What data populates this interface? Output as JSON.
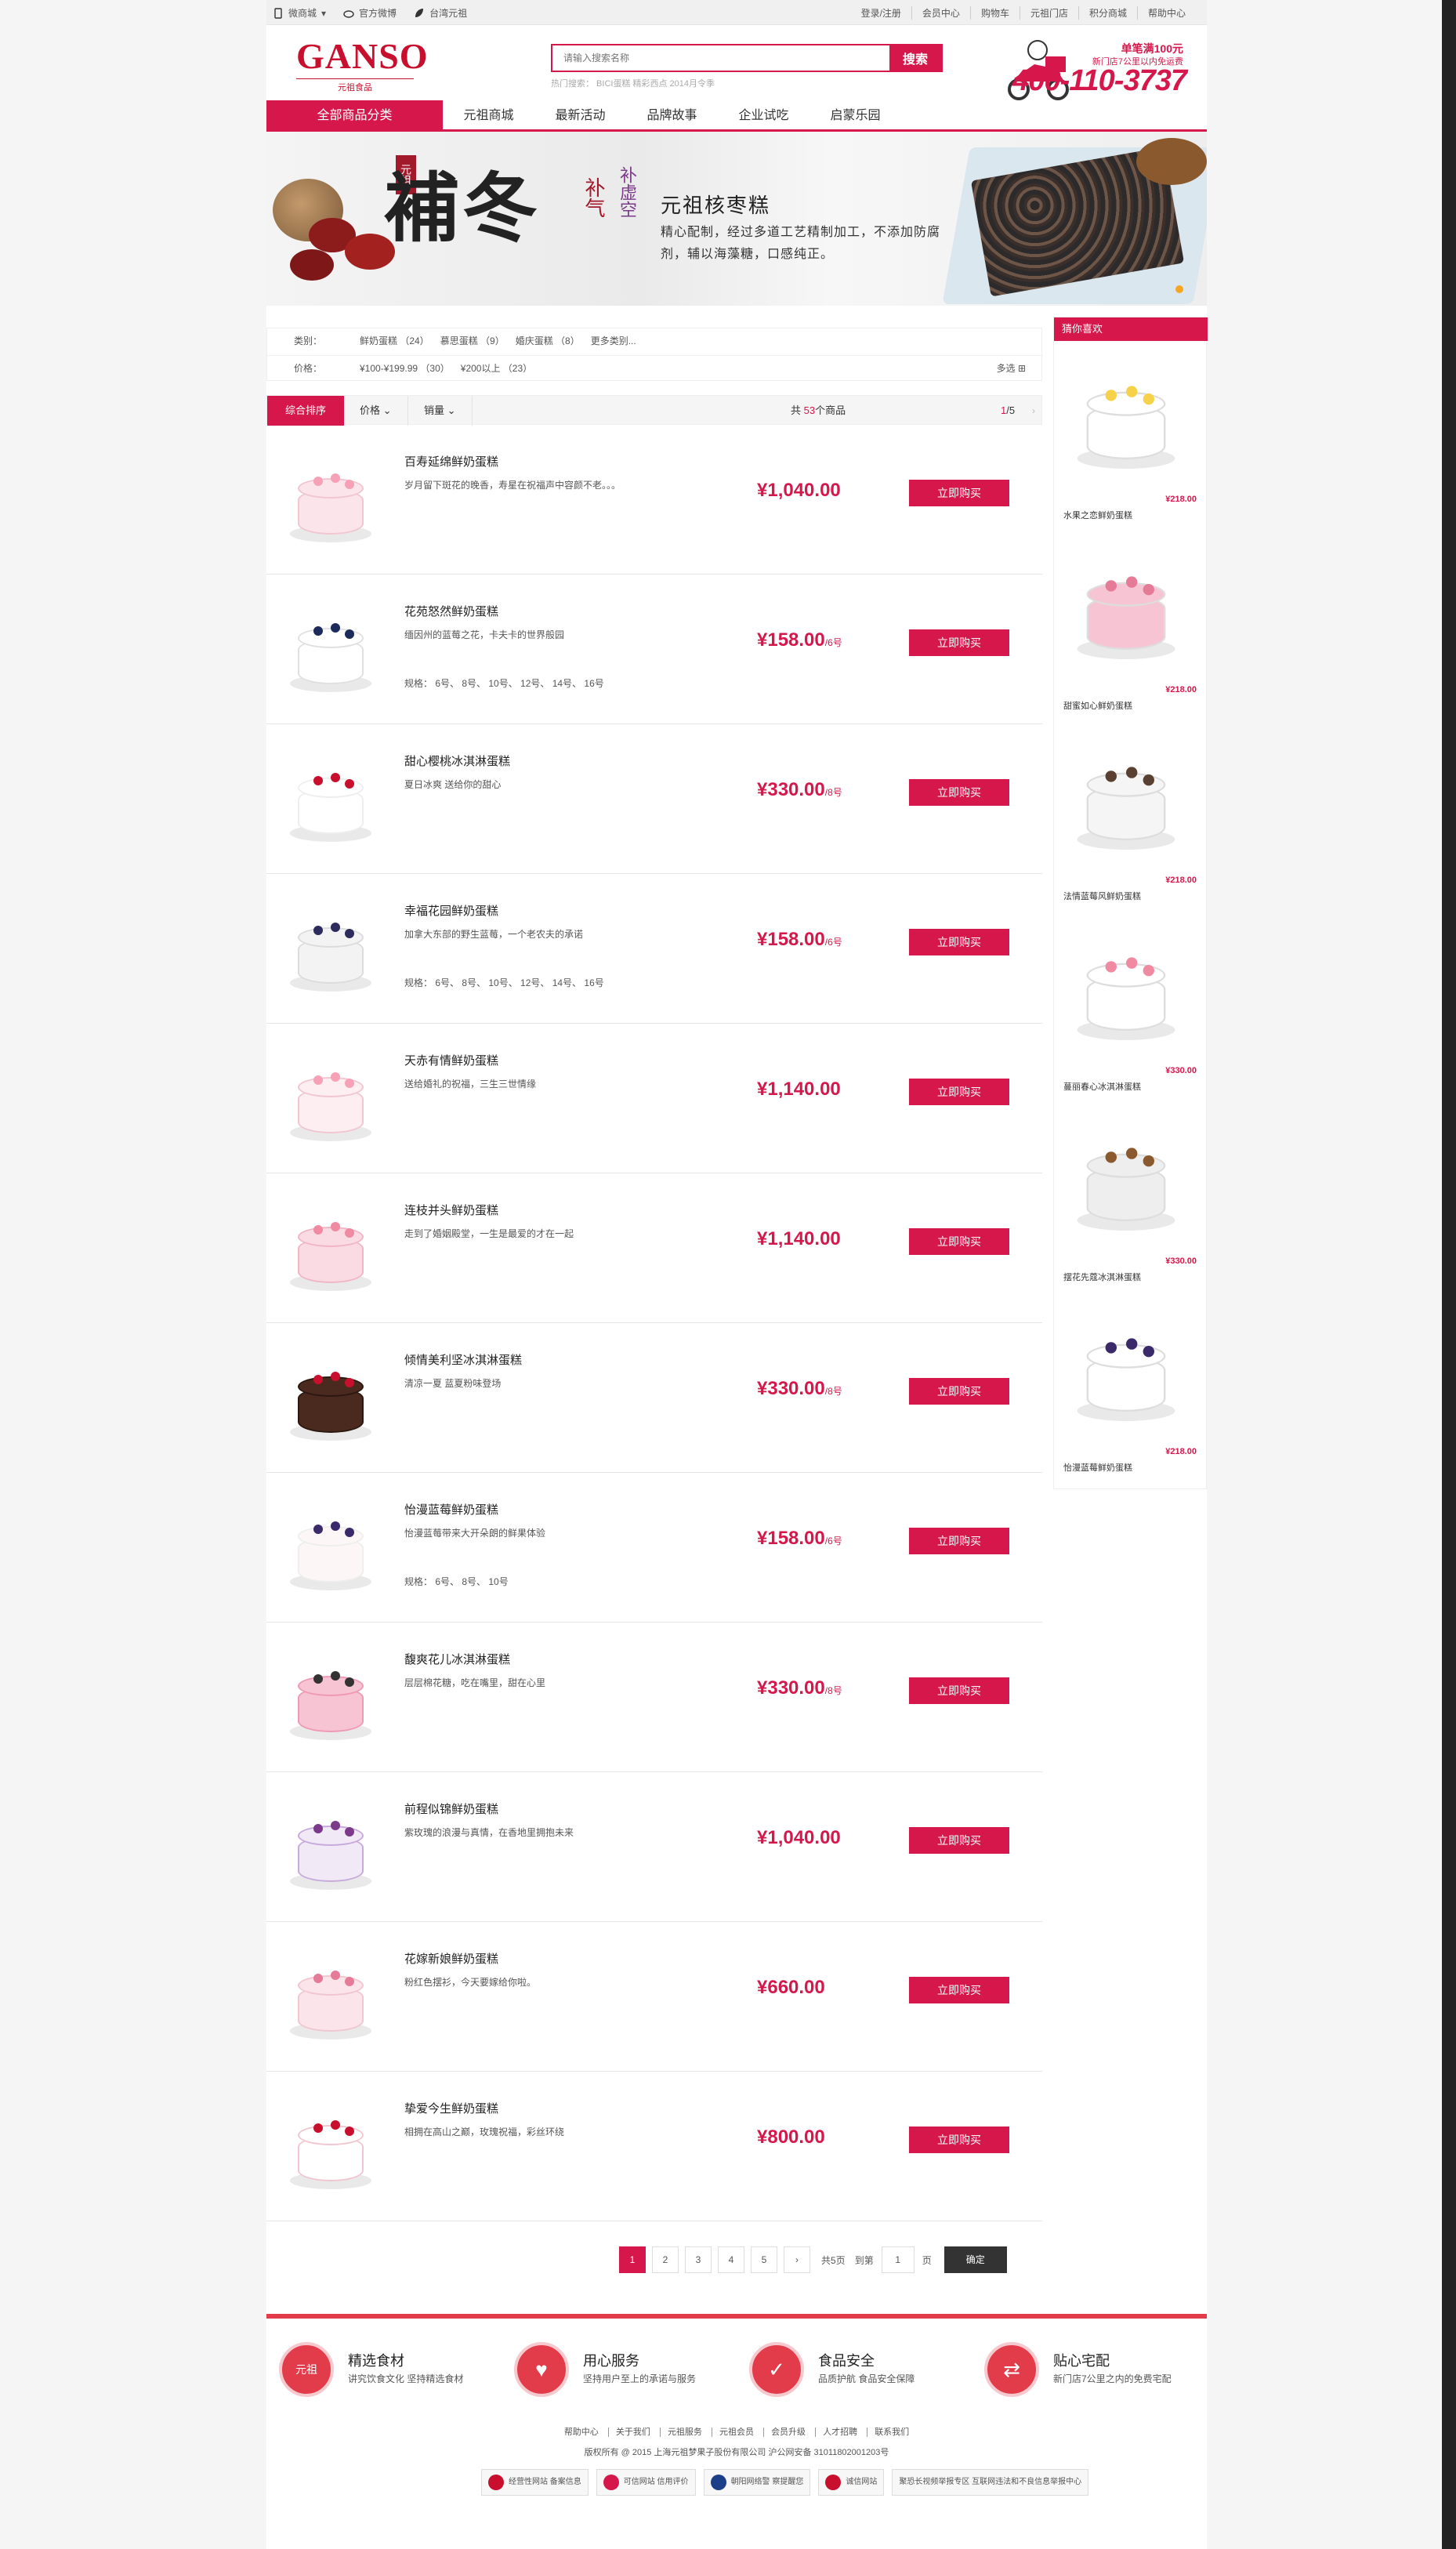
{
  "topbar": {
    "left": [
      "微商城",
      "官方微博",
      "台湾元祖"
    ],
    "right": [
      "登录/注册",
      "会员中心",
      "购物车",
      "元祖门店",
      "积分商城",
      "帮助中心"
    ]
  },
  "header": {
    "logo": "GANSO",
    "logo_sub": "元祖食品",
    "search_placeholder": "请输入搜索名称",
    "search_button": "搜索",
    "hot": "热门搜索：  BICI蛋糕  精彩西点  2014月令季",
    "promo_top": "单笔满100元",
    "promo_mid": "新门店7公里以内免运费",
    "promo_phone": "400-110-3737"
  },
  "nav": {
    "all": "全部商品分类",
    "items": [
      "元祖商城",
      "最新活动",
      "品牌故事",
      "企业试吃",
      "启蒙乐园"
    ]
  },
  "banner": {
    "seal": "元祖",
    "big": "補冬",
    "side1": "补气",
    "side2": "补虚空",
    "title": "元祖核枣糕",
    "desc": "精心配制，经过多道工艺精制加工，不添加防腐剂，辅以海藻糖，口感纯正。"
  },
  "filter": {
    "cat_label": "类别：",
    "cats": [
      "鲜奶蛋糕  （24）",
      "慕思蛋糕  （9）",
      "婚庆蛋糕  （8）",
      "更多类别..."
    ],
    "price_label": "价格：",
    "prices": [
      "¥100-¥199.99  （30）",
      "¥200以上  （23）"
    ],
    "multi": "多选 ⊞"
  },
  "sortbar": {
    "active": "综合排序",
    "price": "价格 ⌄",
    "sales": "销量 ⌄",
    "total_pre": "共 ",
    "total_num": "53",
    "total_post": "个商品",
    "page_cur": "1",
    "page_total": "/5",
    "next": "›"
  },
  "products": [
    {
      "name": "百寿延绵鲜奶蛋糕",
      "desc": "岁月留下斑花的晚香，寿星在祝福声中容颜不老。。。",
      "spec": "",
      "price": "¥1,040.00",
      "unit": "",
      "buy": "立即购买"
    },
    {
      "name": "花苑怒然鲜奶蛋糕",
      "desc": "缅因州的蓝莓之花，卡夫卡的世界般园",
      "spec": "规格：  6号、  8号、  10号、  12号、  14号、  16号",
      "price": "¥158.00",
      "unit": "/6号",
      "buy": "立即购买"
    },
    {
      "name": "甜心樱桃冰淇淋蛋糕",
      "desc": "夏日冰爽 送给你的甜心",
      "spec": "",
      "price": "¥330.00",
      "unit": "/8号",
      "buy": "立即购买"
    },
    {
      "name": "幸福花园鲜奶蛋糕",
      "desc": "加拿大东部的野生蓝莓，一个老农夫的承诺",
      "spec": "规格：  6号、  8号、  10号、  12号、  14号、  16号",
      "price": "¥158.00",
      "unit": "/6号",
      "buy": "立即购买"
    },
    {
      "name": "天赤有情鲜奶蛋糕",
      "desc": "送给婚礼的祝福，三生三世情缘",
      "spec": "",
      "price": "¥1,140.00",
      "unit": "",
      "buy": "立即购买"
    },
    {
      "name": "连枝并头鲜奶蛋糕",
      "desc": "走到了婚姻殿堂，一生是最爱的才在一起",
      "spec": "",
      "price": "¥1,140.00",
      "unit": "",
      "buy": "立即购买"
    },
    {
      "name": "倾情美利坚冰淇淋蛋糕",
      "desc": "清凉一夏 蓝夏粉味登场",
      "spec": "",
      "price": "¥330.00",
      "unit": "/8号",
      "buy": "立即购买"
    },
    {
      "name": "怡漫蓝莓鲜奶蛋糕",
      "desc": "怡漫蓝莓带来大开朵朗的鲜果体验",
      "spec": "规格：  6号、  8号、  10号",
      "price": "¥158.00",
      "unit": "/6号",
      "buy": "立即购买"
    },
    {
      "name": "馥爽花儿冰淇淋蛋糕",
      "desc": "层层棉花糖，吃在嘴里，甜在心里",
      "spec": "",
      "price": "¥330.00",
      "unit": "/8号",
      "buy": "立即购买"
    },
    {
      "name": "前程似锦鲜奶蛋糕",
      "desc": "紫玫瑰的浪漫与真情，在香地里拥抱未来",
      "spec": "",
      "price": "¥1,040.00",
      "unit": "",
      "buy": "立即购买"
    },
    {
      "name": "花嫁新娘鲜奶蛋糕",
      "desc": "粉红色摆衫，今天要嫁给你啦。",
      "spec": "",
      "price": "¥660.00",
      "unit": "",
      "buy": "立即购买"
    },
    {
      "name": "挚爱今生鲜奶蛋糕",
      "desc": "相拥在高山之巅，玫瑰祝福，彩丝环绕",
      "spec": "",
      "price": "¥800.00",
      "unit": "",
      "buy": "立即购买"
    }
  ],
  "sidebar": {
    "title": "猜你喜欢",
    "items": [
      {
        "name": "水果之恋鲜奶蛋糕",
        "price": "¥218.00"
      },
      {
        "name": "甜蜜如心鲜奶蛋糕",
        "price": "¥218.00"
      },
      {
        "name": "法情蓝莓风鲜奶蛋糕",
        "price": "¥218.00"
      },
      {
        "name": "蔓丽春心冰淇淋蛋糕",
        "price": "¥330.00"
      },
      {
        "name": "摆花先蔻冰淇淋蛋糕",
        "price": "¥330.00"
      },
      {
        "name": "怡漫蓝莓鲜奶蛋糕",
        "price": "¥218.00"
      }
    ]
  },
  "pager": {
    "pages": [
      "1",
      "2",
      "3",
      "4",
      "5"
    ],
    "next": "›",
    "total": "共5页",
    "goto": "到第",
    "input": "1",
    "page_word": "页",
    "ok": "确定"
  },
  "footer": {
    "features": [
      {
        "title": "精选食材",
        "desc": "讲究饮食文化 坚持精选食材",
        "icon": "元祖"
      },
      {
        "title": "用心服务",
        "desc": "坚持用户至上的承诺与服务",
        "icon": "♥"
      },
      {
        "title": "食品安全",
        "desc": "品质护航  食品安全保障",
        "icon": "✓"
      },
      {
        "title": "贴心宅配",
        "desc": "新门店7公里之内的免费宅配",
        "icon": "⇄"
      }
    ],
    "links": [
      "帮助中心",
      "关于我们",
      "元祖服务",
      "元祖会员",
      "会员升级",
      "人才招聘",
      "联系我们"
    ],
    "copyright": "版权所有 @ 2015 上海元祖梦果子股份有限公司 沪公网安备 31011802001203号",
    "badges": [
      "经营性网站 备案信息",
      "可信网站 信用评价",
      "朝阳网络警 察提醒您",
      "诚信网站",
      "聚恐长视频举报专区 互联网违法和不良信息举报中心"
    ]
  },
  "colors": {
    "accent": "#d6174b",
    "footer_red": "#e23b4a"
  }
}
